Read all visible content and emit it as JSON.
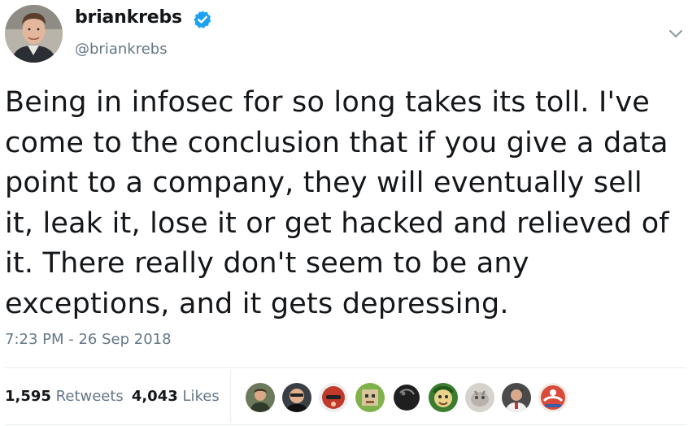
{
  "user": {
    "display_name": "briankrebs",
    "handle": "@briankrebs",
    "verified": true,
    "avatar_icon": "profile-photo-icon"
  },
  "tweet": {
    "lines": [
      "Being in infosec for so long takes its toll. I've",
      "come to the conclusion that if you give a data",
      "point to a company, they will eventually sell",
      "it, leak it, lose it or get hacked and relieved of",
      "it. There really don't seem to be any",
      "exceptions, and it gets depressing."
    ],
    "timestamp": "7:23 PM - 26 Sep 2018"
  },
  "stats": {
    "retweets_count": "1,595",
    "retweets_label": "Retweets",
    "likes_count": "4,043",
    "likes_label": "Likes"
  },
  "likers": [
    {
      "icon": "liker-avatar-1-icon",
      "color": "#6b7a5a"
    },
    {
      "icon": "liker-avatar-2-icon",
      "color": "#3a3f45"
    },
    {
      "icon": "liker-avatar-3-icon",
      "color": "#c0392b"
    },
    {
      "icon": "liker-avatar-4-icon",
      "color": "#7fb24a"
    },
    {
      "icon": "liker-avatar-5-icon",
      "color": "#1f1f1f"
    },
    {
      "icon": "liker-avatar-6-icon",
      "color": "#3b7d2e"
    },
    {
      "icon": "liker-avatar-7-icon",
      "color": "#b8b2ad"
    },
    {
      "icon": "liker-avatar-8-icon",
      "color": "#4a4a4a"
    },
    {
      "icon": "liker-avatar-9-icon",
      "color": "#d84a3a"
    }
  ],
  "colors": {
    "text_primary": "#14171a",
    "text_secondary": "#657786",
    "verified_blue": "#1da1f2",
    "divider": "#e6ecf0"
  }
}
